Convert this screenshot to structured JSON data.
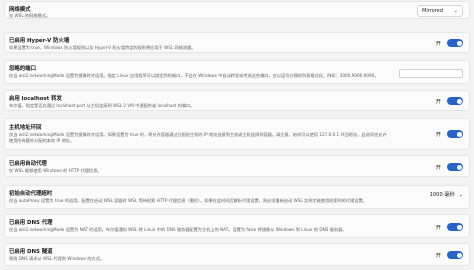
{
  "rows": [
    {
      "title": "网络模式",
      "desc": "仅 WSL 的网络模式。",
      "control": "Mirrored"
    },
    {
      "title": "已启用 Hyper-V 防火墙",
      "desc": "如果设置为 true，Windows 防火墙规则以及 Hyper-V 防火墙特定的规则将应用于 WSL 网络流量。",
      "control": "开"
    },
    {
      "title": "忽略的端口",
      "desc": "仅当 wsl2.networkingMode 设置为镜像时才适用。指定 Linux 应用程序可以绑定到的端口，不会在 Windows 中自动转发或考虑这些端口。应以逗号分隔的列表格式化，例如：3000,9000,9090。",
      "control": ""
    },
    {
      "title": "启用 localhost 转发",
      "desc": "布尔值，指定是否应通过 localhost:port 从主机连接到 WSL 2 VM 中通配符或 localhost 的端口。",
      "control": "开"
    },
    {
      "title": "主机地址环回",
      "desc": "仅当 wsl2.networkingMode 设置为镜像时才适用。如果设置为 true 时，将允许容器通过分配给主机的 IP 地址连接到主机或主机连接到容器。请注意，始终可以使用 127.0.0.1 环回地址，此选项也允许使用所有额外分配的本地 IP 地址。",
      "control": "开"
    },
    {
      "title": "已启用自动代理",
      "desc": "仅 WSL 能够使用 Windows 的 HTTP 代理信息。",
      "control": "开"
    },
    {
      "title": "初始自动代理超时",
      "desc": "仅当 autoProxy 设置为 true 时适用。配置在启动 WSL 容器时 WSL 等待检索 HTTP 代理信息（毫秒）。如果在此时间后解析代理设置，则必须重新启动 WSL 实例才能使用检索到的代理设置。",
      "control": "1000 毫秒"
    },
    {
      "title": "已启用 DNS 代理",
      "desc": "仅当 wsl2.networkingMode 设置为 NAT 时适用。布尔值通知 WSL 将 Linux 中的 DNS 服务器配置为主机上的 NAT。设置为 false 将镜像从 Windows 到 Linux 的 DNS 服务器。",
      "control": "开"
    },
    {
      "title": "已启用 DNS 隧道",
      "desc": "更改 DNS 请求从 WSL 代理到 Windows 的方式。",
      "control": "开"
    }
  ]
}
